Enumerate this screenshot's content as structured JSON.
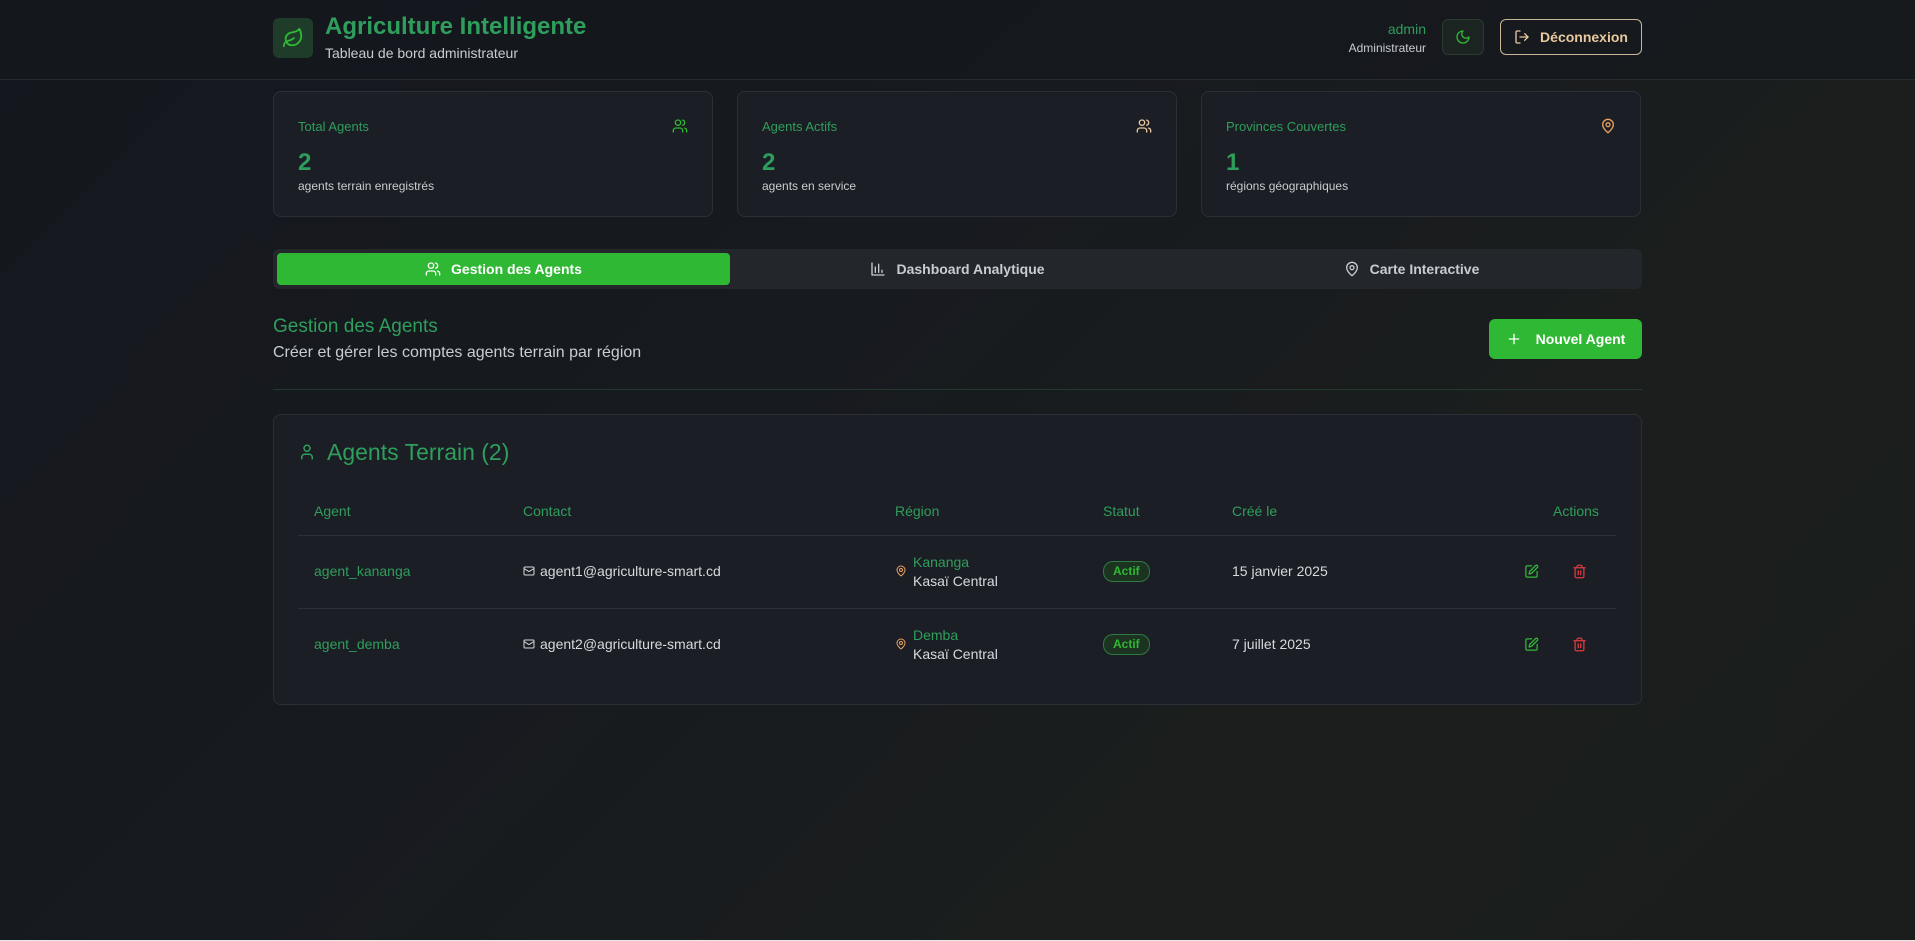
{
  "header": {
    "app_title": "Agriculture Intelligente",
    "app_subtitle": "Tableau de bord administrateur",
    "user_name": "admin",
    "user_role": "Administrateur",
    "logout_label": "Déconnexion"
  },
  "stats": [
    {
      "title": "Total Agents",
      "value": "2",
      "desc": "agents terrain enregistrés",
      "icon": "users-icon"
    },
    {
      "title": "Agents Actifs",
      "value": "2",
      "desc": "agents en service",
      "icon": "users-icon"
    },
    {
      "title": "Provinces Couvertes",
      "value": "1",
      "desc": "régions géographiques",
      "icon": "map-pin-icon"
    }
  ],
  "tabs": [
    {
      "label": "Gestion des Agents",
      "icon": "users-icon",
      "active": true
    },
    {
      "label": "Dashboard Analytique",
      "icon": "bar-chart-icon",
      "active": false
    },
    {
      "label": "Carte Interactive",
      "icon": "map-pin-icon",
      "active": false
    }
  ],
  "section": {
    "title": "Gestion des Agents",
    "subtitle": "Créer et gérer les comptes agents terrain par région",
    "new_button": "Nouvel Agent"
  },
  "table": {
    "title": "Agents Terrain (2)",
    "columns": [
      "Agent",
      "Contact",
      "Région",
      "Statut",
      "Créé le",
      "Actions"
    ],
    "rows": [
      {
        "agent": "agent_kananga",
        "contact": "agent1@agriculture-smart.cd",
        "city": "Kananga",
        "province": "Kasaï Central",
        "status": "Actif",
        "created": "15 janvier 2025"
      },
      {
        "agent": "agent_demba",
        "contact": "agent2@agriculture-smart.cd",
        "city": "Demba",
        "province": "Kasaï Central",
        "status": "Actif",
        "created": "7 juillet 2025"
      }
    ]
  },
  "colors": {
    "accent_green": "#2fb834",
    "text_green": "#2f9e5c",
    "delete_red": "#e0393e",
    "pin_orange": "#e8a060"
  }
}
